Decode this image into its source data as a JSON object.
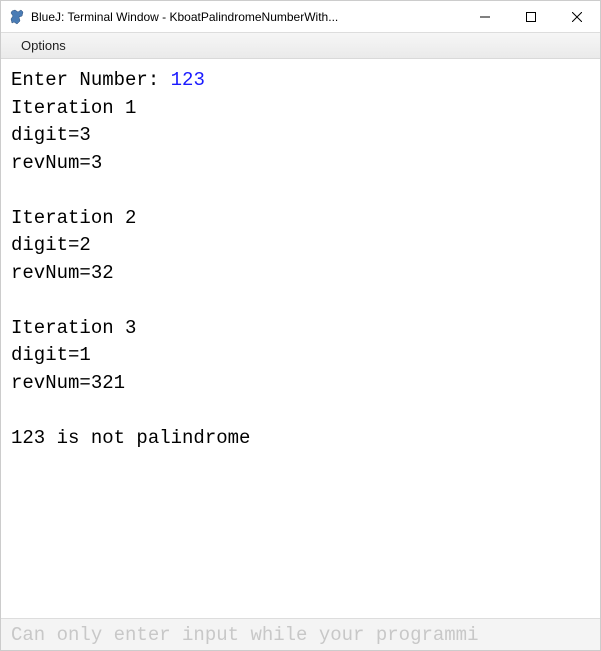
{
  "titlebar": {
    "title": "BlueJ: Terminal Window - KboatPalindromeNumberWith..."
  },
  "menubar": {
    "options_label": "Options"
  },
  "terminal": {
    "prompt": "Enter Number: ",
    "user_input": "123",
    "lines": [
      "Iteration 1",
      "digit=3",
      "revNum=3",
      "",
      "Iteration 2",
      "digit=2",
      "revNum=32",
      "",
      "Iteration 3",
      "digit=1",
      "revNum=321",
      "",
      "123 is not palindrome"
    ]
  },
  "statusbar": {
    "text": "Can only enter input while your programmi"
  }
}
